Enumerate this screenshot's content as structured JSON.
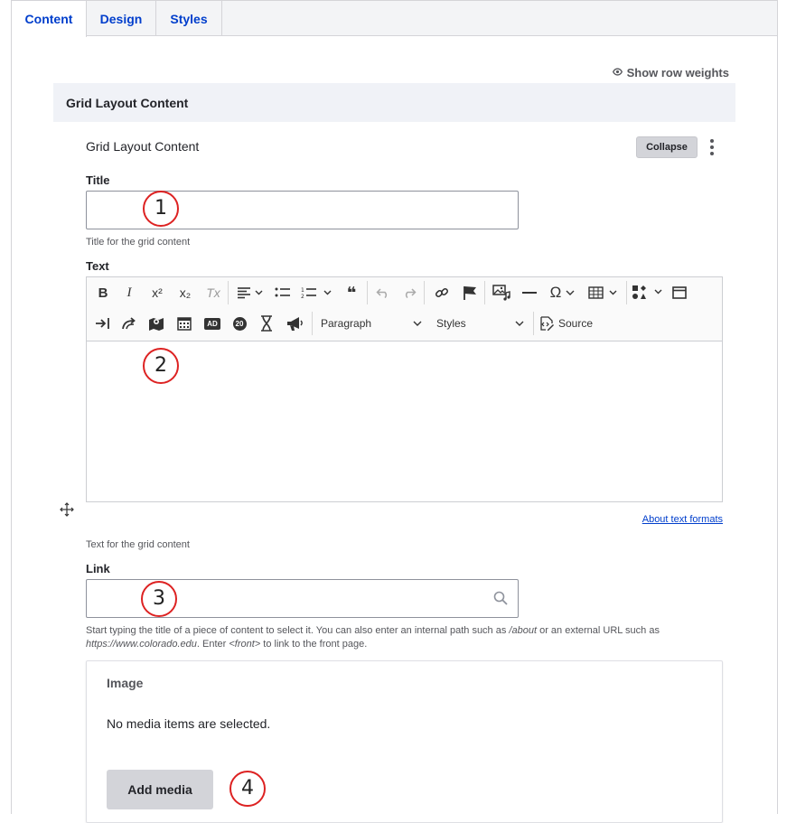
{
  "tabs": [
    {
      "label": "Content",
      "active": true
    },
    {
      "label": "Design",
      "active": false
    },
    {
      "label": "Styles",
      "active": false
    }
  ],
  "row_weights": {
    "label": "Show row weights",
    "icon": "eye-icon"
  },
  "section": {
    "header": "Grid Layout Content"
  },
  "paragraph": {
    "label": "Grid Layout Content",
    "collapse_label": "Collapse"
  },
  "title_field": {
    "label": "Title",
    "value": "",
    "description": "Title for the grid content"
  },
  "text_field": {
    "label": "Text",
    "format_dropdown": "Paragraph",
    "styles_dropdown": "Styles",
    "source_label": "Source",
    "about_formats": "About text formats",
    "description": "Text for the grid content",
    "toolbar_icons_row1": [
      "bold-icon",
      "italic-icon",
      "superscript-icon",
      "subscript-icon",
      "remove-format-icon",
      "align-icon",
      "bulleted-list-icon",
      "numbered-list-icon",
      "blockquote-icon",
      "undo-icon",
      "redo-icon",
      "link-icon",
      "anchor-flag-icon",
      "insert-image-icon",
      "horizontal-line-icon",
      "special-characters-icon",
      "table-icon",
      "icon-picker-icon",
      "fullscreen-box-icon"
    ],
    "toolbar_icons_row2": [
      "button-link-icon",
      "shortcut-icon",
      "map-icon",
      "calendar-icon",
      "ad-icon",
      "countdown-icon",
      "hourglass-icon",
      "announcement-icon"
    ],
    "toolbar_texts": {
      "bold": "B",
      "italic": "I",
      "superscript": "x²",
      "subscript": "x₂",
      "clear_format": "Tx",
      "ad": "AD",
      "countdown": "20",
      "special_characters": "Ω",
      "quote": "❝"
    }
  },
  "link_field": {
    "label": "Link",
    "value": "",
    "description_parts": {
      "p1": "Start typing the title of a piece of content to select it. You can also enter an internal path such as ",
      "path_example": "/about",
      "p2": " or an external URL such as",
      "url_example": "https://www.colorado.edu",
      "p3": ". Enter ",
      "front": "<front>",
      "p4": " to link to the front page."
    }
  },
  "image_field": {
    "label": "Image",
    "empty_text": "No media items are selected.",
    "button": "Add media"
  },
  "markers": [
    "1",
    "2",
    "3",
    "4"
  ],
  "colors": {
    "accent": "#003ecc",
    "marker_ring": "#dd2222",
    "header_bg": "#f0f2f7",
    "button_bg": "#d3d4d9"
  }
}
